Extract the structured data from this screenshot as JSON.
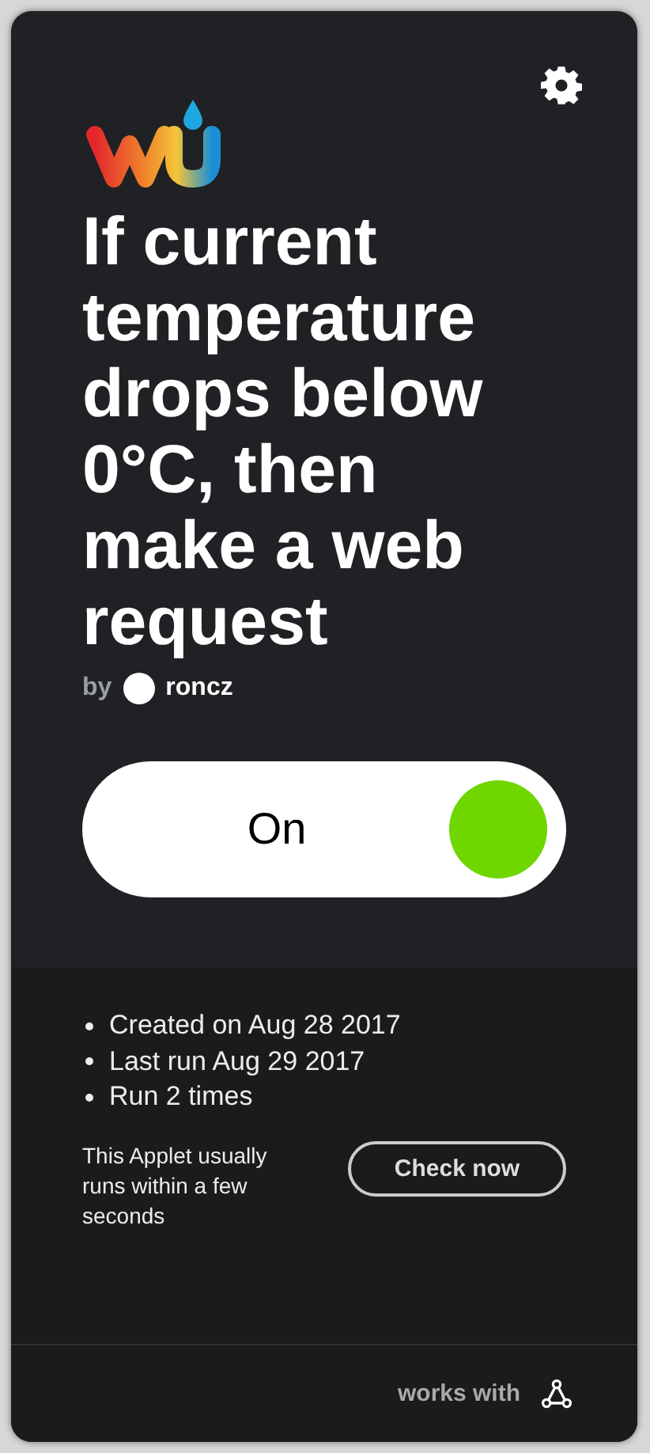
{
  "title": "If current temperature drops below 0°C, then make a web request",
  "author": {
    "prefix": "by",
    "name": "roncz"
  },
  "toggle": {
    "label": "On",
    "on": true
  },
  "stats": [
    "Created on Aug 28 2017",
    "Last run Aug 29 2017",
    "Run 2 times"
  ],
  "note": "This Applet usually runs within a few seconds",
  "check_button": "Check now",
  "footer": {
    "label": "works with"
  }
}
